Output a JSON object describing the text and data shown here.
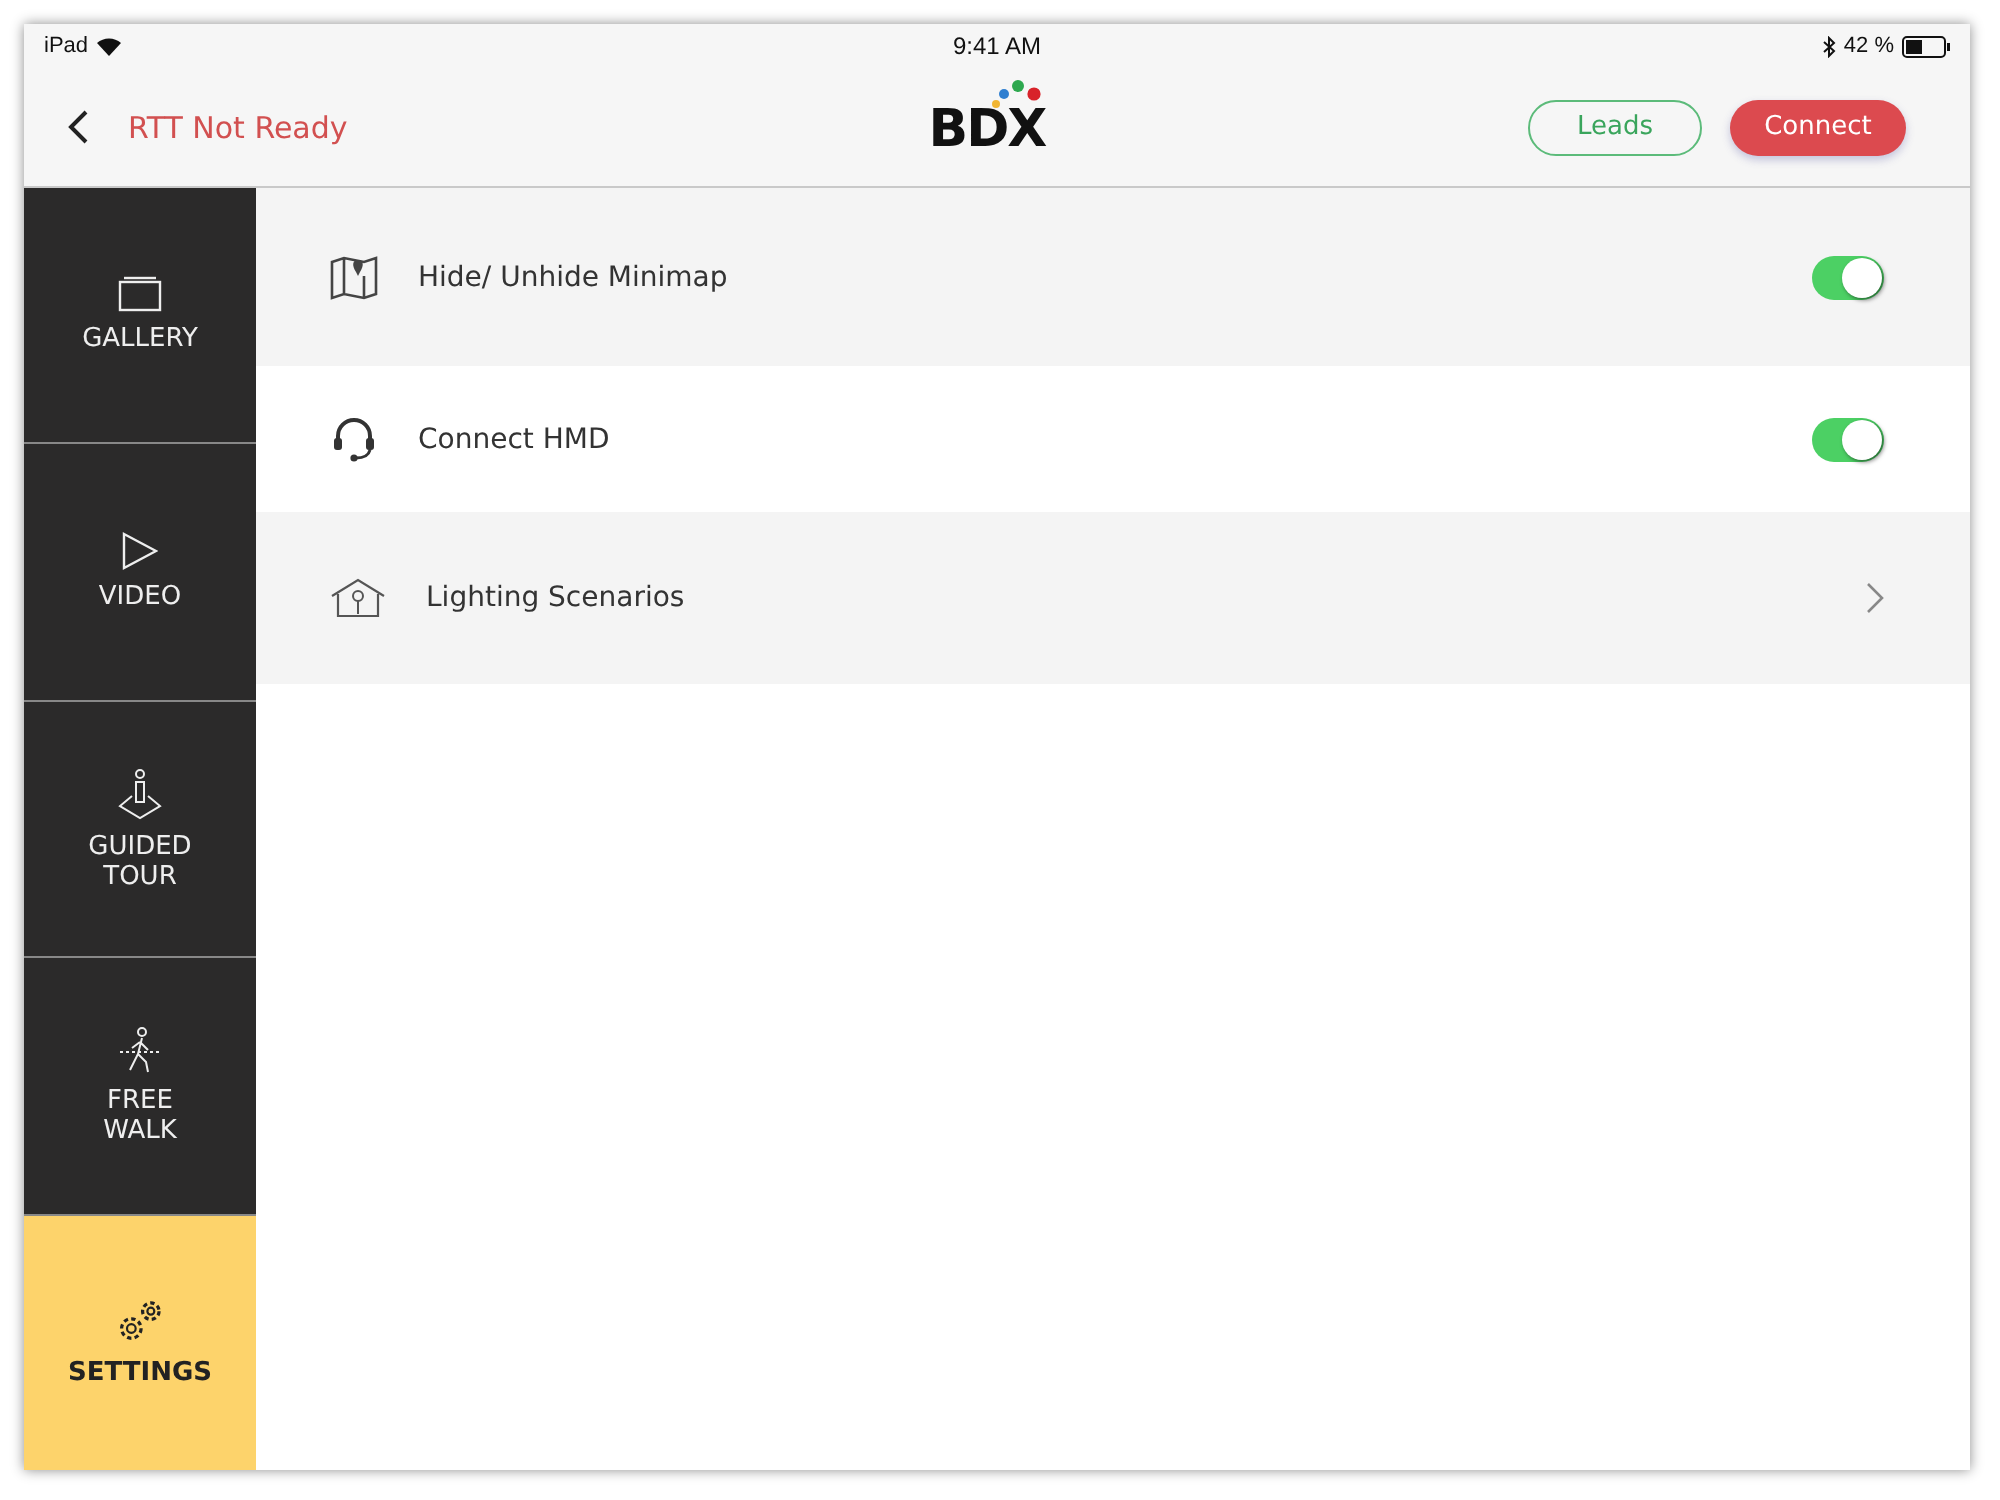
{
  "status_bar": {
    "device": "iPad",
    "time": "9:41 AM",
    "battery": "42 %"
  },
  "nav": {
    "back_label": "RTT Not Ready",
    "logo": "BDX",
    "buttons": [
      {
        "label": "Leads",
        "kind": "outline"
      },
      {
        "label": "Connect",
        "kind": "filled"
      }
    ]
  },
  "sidebar": {
    "items": [
      {
        "label": "GALLERY",
        "selected": false
      },
      {
        "label": "VIDEO",
        "selected": false
      },
      {
        "label": "GUIDED TOUR",
        "selected": false
      },
      {
        "label": "FREE WALK",
        "selected": false
      },
      {
        "label": "SETTINGS",
        "selected": true
      }
    ]
  },
  "settings": [
    {
      "label": "Hide/ Unhide Minimap",
      "kind": "toggle",
      "on": true
    },
    {
      "label": "Connect HMD",
      "kind": "toggle",
      "on": true
    },
    {
      "label": "Lighting Scenarios",
      "kind": "link"
    }
  ]
}
